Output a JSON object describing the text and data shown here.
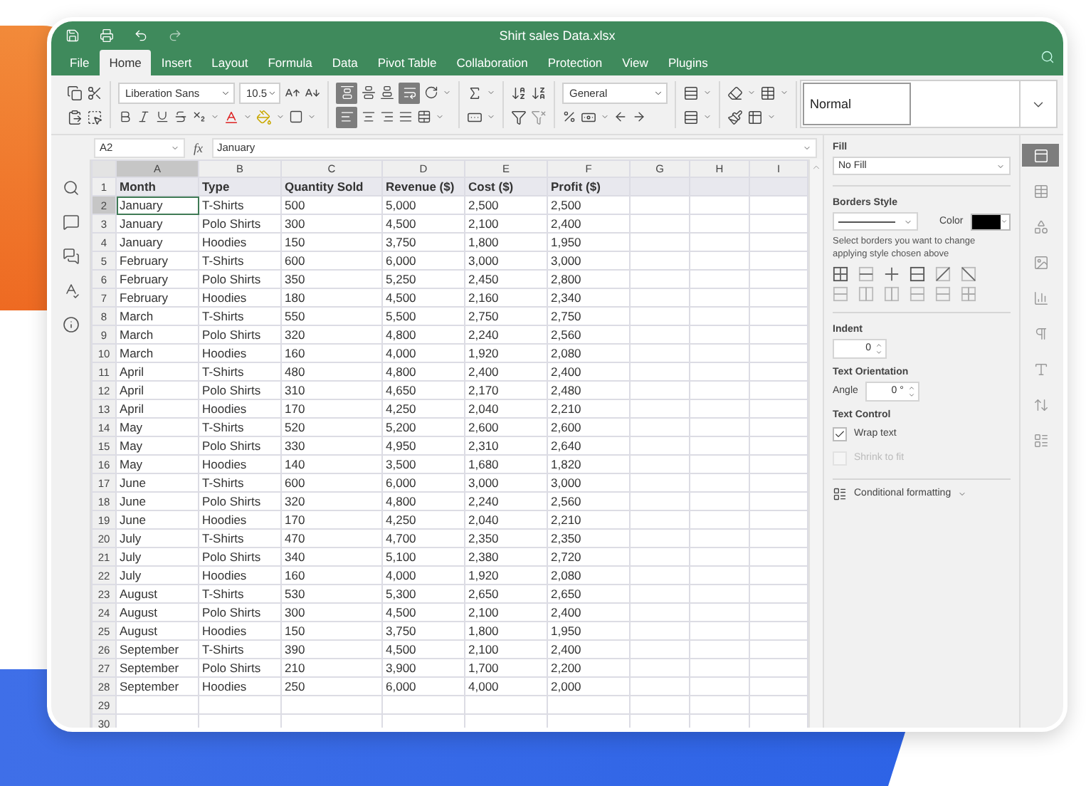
{
  "window": {
    "title": "Shirt sales Data.xlsx"
  },
  "menu_tabs": [
    {
      "label": "File",
      "selected": false
    },
    {
      "label": "Home",
      "selected": true
    },
    {
      "label": "Insert",
      "selected": false
    },
    {
      "label": "Layout",
      "selected": false
    },
    {
      "label": "Formula",
      "selected": false
    },
    {
      "label": "Data",
      "selected": false
    },
    {
      "label": "Pivot Table",
      "selected": false
    },
    {
      "label": "Collaboration",
      "selected": false
    },
    {
      "label": "Protection",
      "selected": false
    },
    {
      "label": "View",
      "selected": false
    },
    {
      "label": "Plugins",
      "selected": false
    }
  ],
  "toolbar": {
    "font_name": "Liberation Sans",
    "font_size": "10.5",
    "number_format": "General",
    "cell_style": "Normal",
    "align_top_on": true,
    "wrap_on": true,
    "align_left_on": true
  },
  "formula_bar": {
    "cell_ref": "A2",
    "function_label": "fx",
    "value": "January"
  },
  "sheet": {
    "columns": [
      {
        "label": "A",
        "selected": true
      },
      {
        "label": "B",
        "selected": false
      },
      {
        "label": "C",
        "selected": false
      },
      {
        "label": "D",
        "selected": false
      },
      {
        "label": "E",
        "selected": false
      },
      {
        "label": "F",
        "selected": false
      },
      {
        "label": "G",
        "selected": false
      },
      {
        "label": "H",
        "selected": false
      },
      {
        "label": "I",
        "selected": false
      }
    ],
    "rows": [
      {
        "number": "1",
        "selected": false,
        "kind": "header",
        "cells": [
          "Month",
          "Type",
          "Quantity Sold",
          "Revenue ($)",
          "Cost ($)",
          "Profit ($)"
        ]
      },
      {
        "number": "2",
        "selected": true,
        "kind": "data",
        "cells": [
          "January",
          "T-Shirts",
          "500",
          "5,000",
          "2,500",
          "2,500"
        ]
      },
      {
        "number": "3",
        "selected": false,
        "kind": "data",
        "cells": [
          "January",
          "Polo Shirts",
          "300",
          "4,500",
          "2,100",
          "2,400"
        ]
      },
      {
        "number": "4",
        "selected": false,
        "kind": "data",
        "cells": [
          "January",
          "Hoodies",
          "150",
          "3,750",
          "1,800",
          "1,950"
        ]
      },
      {
        "number": "5",
        "selected": false,
        "kind": "data",
        "cells": [
          "February",
          "T-Shirts",
          "600",
          "6,000",
          "3,000",
          "3,000"
        ]
      },
      {
        "number": "6",
        "selected": false,
        "kind": "data",
        "cells": [
          "February",
          "Polo Shirts",
          "350",
          "5,250",
          "2,450",
          "2,800"
        ]
      },
      {
        "number": "7",
        "selected": false,
        "kind": "data",
        "cells": [
          "February",
          "Hoodies",
          "180",
          "4,500",
          "2,160",
          "2,340"
        ]
      },
      {
        "number": "8",
        "selected": false,
        "kind": "data",
        "cells": [
          "March",
          "T-Shirts",
          "550",
          "5,500",
          "2,750",
          "2,750"
        ]
      },
      {
        "number": "9",
        "selected": false,
        "kind": "data",
        "cells": [
          "March",
          "Polo Shirts",
          "320",
          "4,800",
          "2,240",
          "2,560"
        ]
      },
      {
        "number": "10",
        "selected": false,
        "kind": "data",
        "cells": [
          "March",
          "Hoodies",
          "160",
          "4,000",
          "1,920",
          "2,080"
        ]
      },
      {
        "number": "11",
        "selected": false,
        "kind": "data",
        "cells": [
          "April",
          "T-Shirts",
          "480",
          "4,800",
          "2,400",
          "2,400"
        ]
      },
      {
        "number": "12",
        "selected": false,
        "kind": "data",
        "cells": [
          "April",
          "Polo Shirts",
          "310",
          "4,650",
          "2,170",
          "2,480"
        ]
      },
      {
        "number": "13",
        "selected": false,
        "kind": "data",
        "cells": [
          "April",
          "Hoodies",
          "170",
          "4,250",
          "2,040",
          "2,210"
        ]
      },
      {
        "number": "14",
        "selected": false,
        "kind": "data",
        "cells": [
          "May",
          "T-Shirts",
          "520",
          "5,200",
          "2,600",
          "2,600"
        ]
      },
      {
        "number": "15",
        "selected": false,
        "kind": "data",
        "cells": [
          "May",
          "Polo Shirts",
          "330",
          "4,950",
          "2,310",
          "2,640"
        ]
      },
      {
        "number": "16",
        "selected": false,
        "kind": "data",
        "cells": [
          "May",
          "Hoodies",
          "140",
          "3,500",
          "1,680",
          "1,820"
        ]
      },
      {
        "number": "17",
        "selected": false,
        "kind": "data",
        "cells": [
          "June",
          "T-Shirts",
          "600",
          "6,000",
          "3,000",
          "3,000"
        ]
      },
      {
        "number": "18",
        "selected": false,
        "kind": "data",
        "cells": [
          "June",
          "Polo Shirts",
          "320",
          "4,800",
          "2,240",
          "2,560"
        ]
      },
      {
        "number": "19",
        "selected": false,
        "kind": "data",
        "cells": [
          "June",
          "Hoodies",
          "170",
          "4,250",
          "2,040",
          "2,210"
        ]
      },
      {
        "number": "20",
        "selected": false,
        "kind": "data",
        "cells": [
          "July",
          "T-Shirts",
          "470",
          "4,700",
          "2,350",
          "2,350"
        ]
      },
      {
        "number": "21",
        "selected": false,
        "kind": "data",
        "cells": [
          "July",
          "Polo Shirts",
          "340",
          "5,100",
          "2,380",
          "2,720"
        ]
      },
      {
        "number": "22",
        "selected": false,
        "kind": "data",
        "cells": [
          "July",
          "Hoodies",
          "160",
          "4,000",
          "1,920",
          "2,080"
        ]
      },
      {
        "number": "23",
        "selected": false,
        "kind": "data",
        "cells": [
          "August",
          "T-Shirts",
          "530",
          "5,300",
          "2,650",
          "2,650"
        ]
      },
      {
        "number": "24",
        "selected": false,
        "kind": "data",
        "cells": [
          "August",
          "Polo Shirts",
          "300",
          "4,500",
          "2,100",
          "2,400"
        ]
      },
      {
        "number": "25",
        "selected": false,
        "kind": "data",
        "cells": [
          "August",
          "Hoodies",
          "150",
          "3,750",
          "1,800",
          "1,950"
        ]
      },
      {
        "number": "26",
        "selected": false,
        "kind": "data",
        "cells": [
          "September",
          "T-Shirts",
          "390",
          "4,500",
          "2,100",
          "2,400"
        ]
      },
      {
        "number": "27",
        "selected": false,
        "kind": "data",
        "cells": [
          "September",
          "Polo Shirts",
          "210",
          "3,900",
          "1,700",
          "2,200"
        ]
      },
      {
        "number": "28",
        "selected": false,
        "kind": "data",
        "cells": [
          "September",
          "Hoodies",
          "250",
          "6,000",
          "4,000",
          "2,000"
        ]
      },
      {
        "number": "29",
        "selected": false,
        "kind": "data"
      },
      {
        "number": "30",
        "selected": false,
        "kind": "data"
      }
    ]
  },
  "format_panel": {
    "fill_title": "Fill",
    "fill_value": "No Fill",
    "borders_title": "Borders Style",
    "color_label": "Color",
    "borders_hint": "Select borders you want to change applying style chosen above",
    "indent_title": "Indent",
    "indent_value": "0",
    "orientation_title": "Text Orientation",
    "angle_label": "Angle",
    "angle_value": "0 °",
    "text_control_title": "Text Control",
    "options": [
      {
        "label": "Wrap text",
        "checked": true,
        "disabled": false
      },
      {
        "label": "Shrink to fit",
        "checked": false,
        "disabled": true
      }
    ],
    "conditional_formatting": "Conditional formatting"
  },
  "right_rail": [
    {
      "selected": true
    },
    {
      "selected": false
    },
    {
      "selected": false
    },
    {
      "selected": false
    },
    {
      "selected": false
    },
    {
      "selected": false
    },
    {
      "selected": false
    },
    {
      "selected": false
    },
    {
      "selected": false
    }
  ]
}
